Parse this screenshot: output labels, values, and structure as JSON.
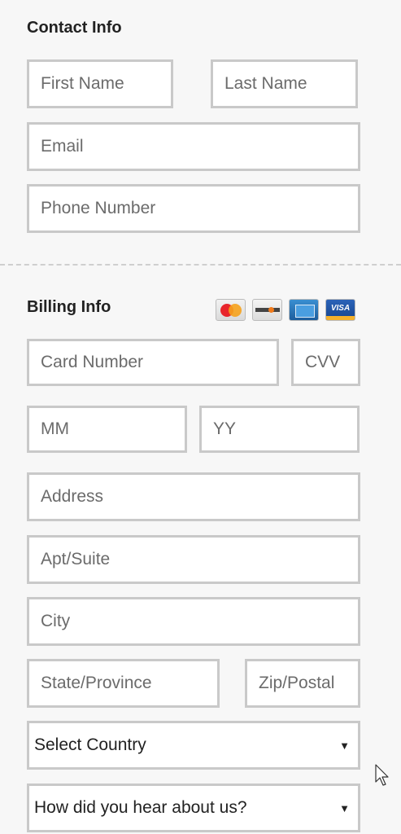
{
  "contact": {
    "title": "Contact Info",
    "first_name_placeholder": "First Name",
    "last_name_placeholder": "Last Name",
    "email_placeholder": "Email",
    "phone_placeholder": "Phone Number"
  },
  "billing": {
    "title": "Billing Info",
    "card_icons": [
      "mastercard-icon",
      "discover-icon",
      "amex-icon",
      "visa-icon"
    ],
    "visa_text": "VISA",
    "card_number_placeholder": "Card Number",
    "cvv_placeholder": "CVV",
    "mm_placeholder": "MM",
    "yy_placeholder": "YY",
    "address_placeholder": "Address",
    "apt_placeholder": "Apt/Suite",
    "city_placeholder": "City",
    "state_placeholder": "State/Province",
    "zip_placeholder": "Zip/Postal",
    "country_select": "Select Country",
    "referral_select": "How did you hear about us?",
    "select_arrow": "▼"
  },
  "colors": {
    "background": "#f7f7f7",
    "field_border": "#c9c9c9",
    "text": "#222222",
    "placeholder": "#6b6b6b"
  }
}
